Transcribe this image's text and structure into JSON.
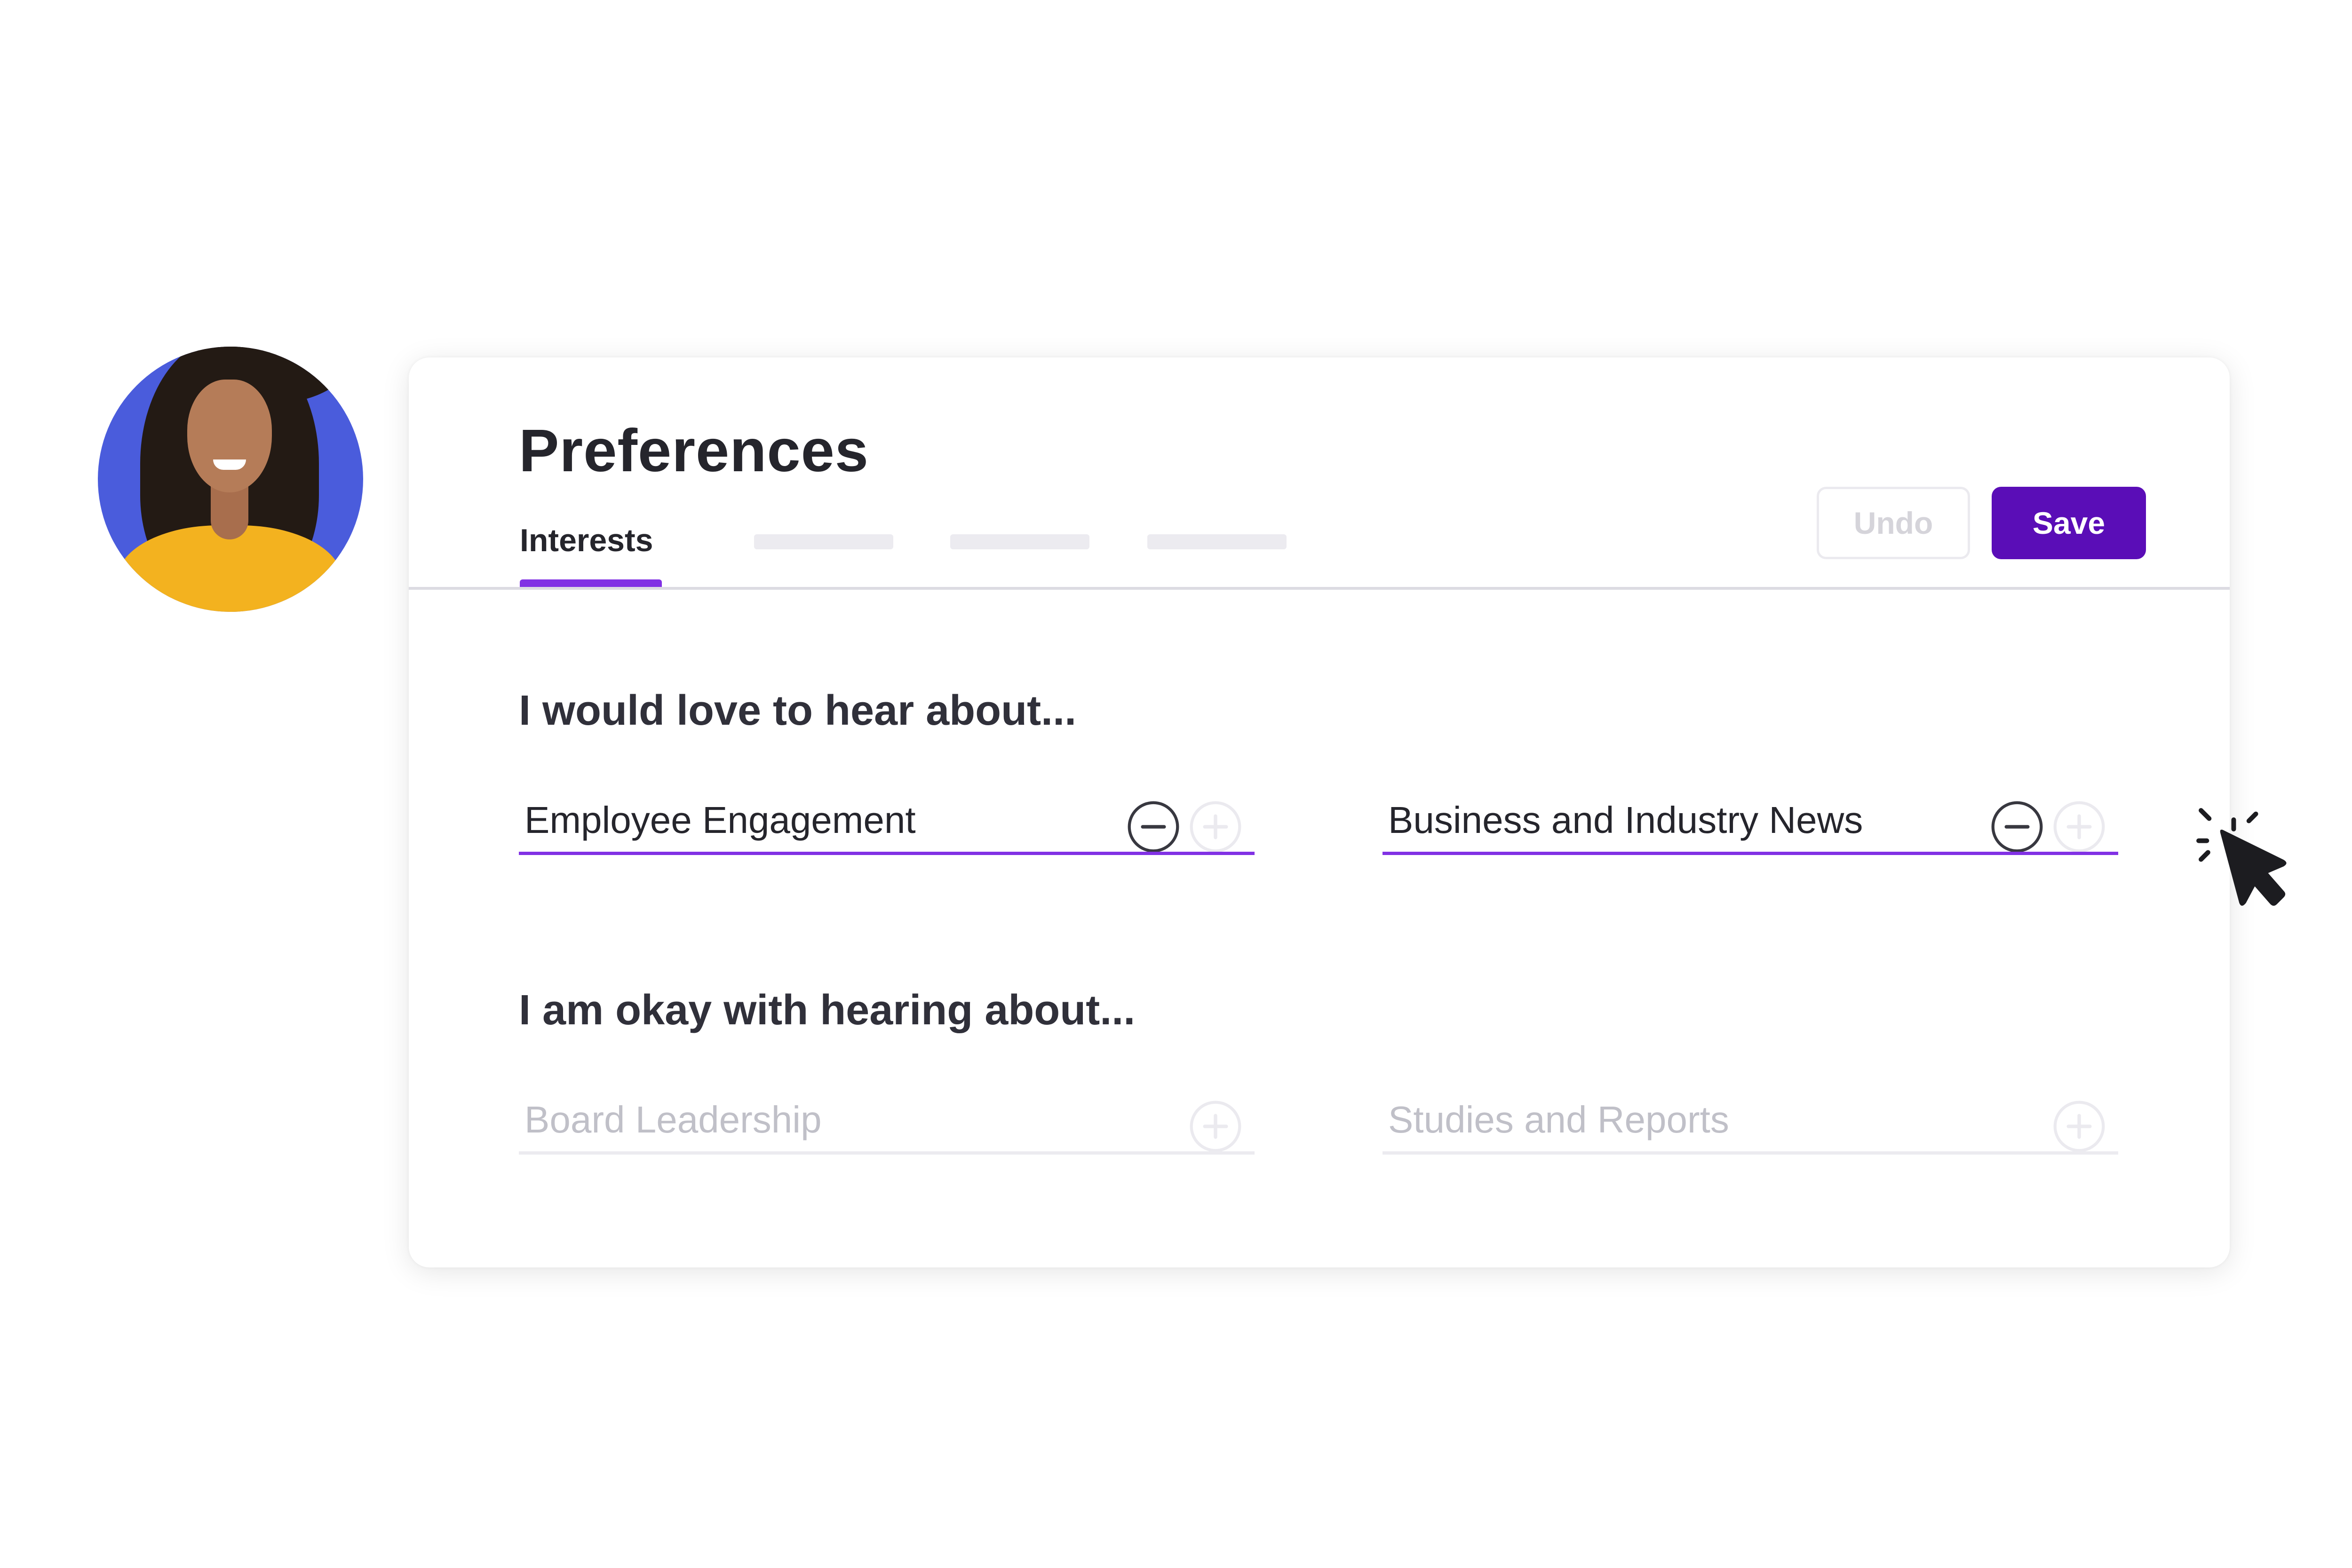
{
  "avatar": {
    "description": "profile-photo-woman-yellow-shirt",
    "background_color": "#4a5cdc"
  },
  "card": {
    "title": "Preferences",
    "tabs": [
      {
        "label": "Interests",
        "active": true
      },
      {
        "label": "",
        "placeholder": true
      },
      {
        "label": "",
        "placeholder": true
      },
      {
        "label": "",
        "placeholder": true
      }
    ],
    "buttons": {
      "undo": "Undo",
      "save": "Save"
    },
    "accent_color": "#8131e4",
    "primary_button_color": "#5a0db7",
    "sections": [
      {
        "heading": "I would love to hear about...",
        "items": [
          {
            "label": "Employee Engagement",
            "selected": true,
            "icons": [
              "minus-circle-icon",
              "plus-circle-icon"
            ]
          },
          {
            "label": "Business and Industry News",
            "selected": true,
            "icons": [
              "minus-circle-icon",
              "plus-circle-icon"
            ]
          }
        ]
      },
      {
        "heading": "I am okay with hearing about...",
        "items": [
          {
            "label": "Board Leadership",
            "selected": false,
            "icons": [
              "plus-circle-icon"
            ]
          },
          {
            "label": "Studies and Reports",
            "selected": false,
            "icons": [
              "plus-circle-icon"
            ]
          }
        ]
      }
    ]
  },
  "cursor": {
    "icon": "click-cursor-icon"
  }
}
